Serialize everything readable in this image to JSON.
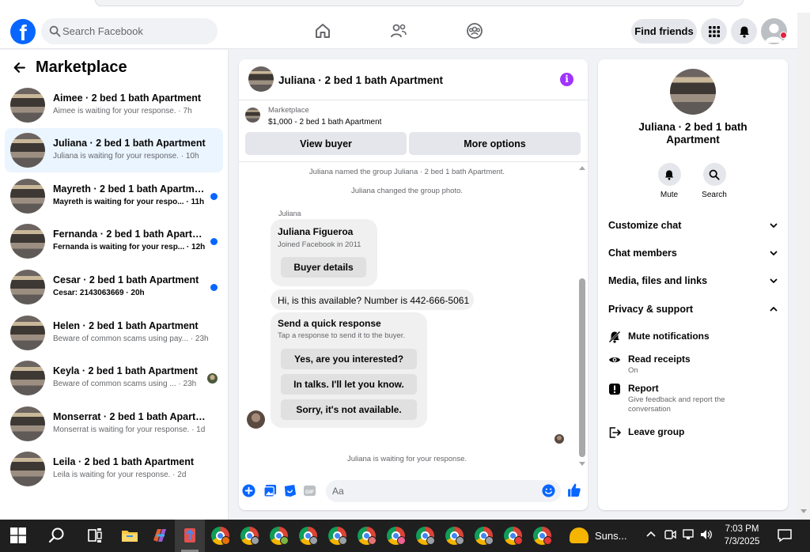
{
  "topbar": {
    "search_placeholder": "Search Facebook",
    "find_friends": "Find friends"
  },
  "marketplace": {
    "title": "Marketplace",
    "conversations": [
      {
        "name": "Aimee · 2 bed 1 bath Apartment",
        "preview": "Aimee is waiting for your response. · 7h",
        "unread": false,
        "active": false,
        "indicator": "none"
      },
      {
        "name": "Juliana · 2 bed 1 bath Apartment",
        "preview": "Juliana is waiting for your response. · 10h",
        "unread": false,
        "active": true,
        "indicator": "none"
      },
      {
        "name": "Mayreth · 2 bed 1 bath Apartment",
        "preview": "Mayreth is waiting for your respo... · 11h",
        "unread": true,
        "active": false,
        "indicator": "dot"
      },
      {
        "name": "Fernanda · 2 bed 1 bath Apartme...",
        "preview": "Fernanda is waiting for your resp... · 12h",
        "unread": true,
        "active": false,
        "indicator": "dot"
      },
      {
        "name": "Cesar · 2 bed 1 bath Apartment",
        "preview": "Cesar: 2143063669 · 20h",
        "unread": true,
        "active": false,
        "indicator": "dot"
      },
      {
        "name": "Helen · 2 bed 1 bath Apartment",
        "preview": "Beware of common scams using pay... · 23h",
        "unread": false,
        "active": false,
        "indicator": "none"
      },
      {
        "name": "Keyla · 2 bed 1 bath Apartment",
        "preview": "Beware of common scams using ... · 23h",
        "unread": false,
        "active": false,
        "indicator": "avatar"
      },
      {
        "name": "Monserrat · 2 bed 1 bath Apartment",
        "preview": "Monserrat is waiting for your response. · 1d",
        "unread": false,
        "active": false,
        "indicator": "none"
      },
      {
        "name": "Leila · 2 bed 1 bath Apartment",
        "preview": "Leila is waiting for your response. · 2d",
        "unread": false,
        "active": false,
        "indicator": "none"
      }
    ]
  },
  "chat": {
    "title": "Juliana · 2 bed 1 bath Apartment",
    "marketplace_label": "Marketplace",
    "listing": "$1,000 - 2 bed 1 bath Apartment",
    "view_buyer": "View buyer",
    "more_options": "More options",
    "system_1": "Juliana named the group Juliana · 2 bed 1 bath Apartment.",
    "system_2": "Juliana changed the group photo.",
    "sender": "Juliana",
    "profile_name": "Juliana Figueroa",
    "profile_sub": "Joined Facebook in 2011",
    "buyer_details": "Buyer details",
    "message": "Hi, is this available? Number is 442-666-5061",
    "quick_title": "Send a quick response",
    "quick_sub": "Tap a response to send it to the buyer.",
    "quick_1": "Yes, are you interested?",
    "quick_2": "In talks. I'll let you know.",
    "quick_3": "Sorry, it's not available.",
    "waiting": "Juliana is waiting for your response.",
    "composer_placeholder": "Aa"
  },
  "details": {
    "title": "Juliana · 2 bed 1 bath Apartment",
    "mute": "Mute",
    "search": "Search",
    "customize_chat": "Customize chat",
    "chat_members": "Chat members",
    "media": "Media, files and links",
    "privacy": "Privacy & support",
    "mute_notifications": "Mute notifications",
    "read_receipts": "Read receipts",
    "read_receipts_state": "On",
    "report": "Report",
    "report_sub": "Give feedback and report the conversation",
    "leave_group": "Leave group"
  },
  "taskbar": {
    "weather": "Suns...",
    "time": "7:03 PM",
    "date": "7/3/2025"
  },
  "colors": {
    "brand": "#0866ff",
    "accent_purple": "#a033ff",
    "unread_dot": "#0866ff",
    "active_row": "#ebf5ff"
  }
}
